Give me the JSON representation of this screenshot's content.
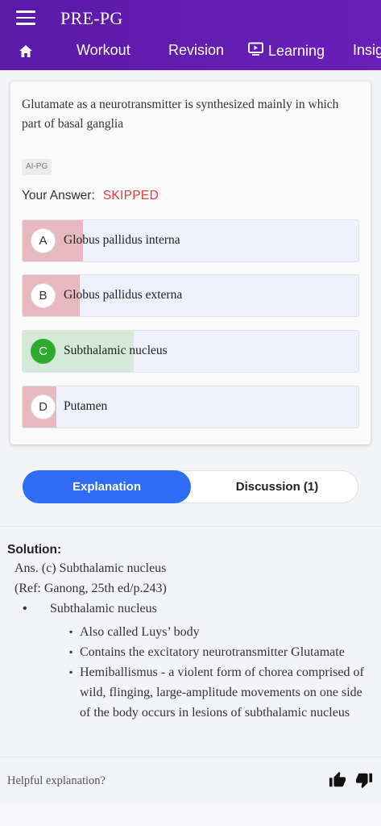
{
  "app": {
    "title": "PRE-PG"
  },
  "nav": {
    "items": [
      "Workout",
      "Revision",
      "Learning",
      "Insig"
    ]
  },
  "question": {
    "text": "Glutamate as a neurotransmitter is synthesized mainly in which part of basal ganglia",
    "tag": "AI-PG",
    "your_answer_label": "Your Answer:",
    "your_answer_status": "SKIPPED",
    "options": [
      {
        "letter": "A",
        "text": "Globus pallidus interna",
        "response_share": 0.18,
        "fill_color": "#e7b8c0"
      },
      {
        "letter": "B",
        "text": "Globus pallidus externa",
        "response_share": 0.17,
        "fill_color": "#e7b8c0"
      },
      {
        "letter": "C",
        "text": "Subthalamic nucleus",
        "response_share": 0.33,
        "fill_color": "#d5e9d9",
        "correct": true
      },
      {
        "letter": "D",
        "text": "Putamen",
        "response_share": 0.1,
        "fill_color": "#e7b8c0"
      }
    ]
  },
  "tabs": {
    "explanation": "Explanation",
    "discussion": "Discussion (1)"
  },
  "solution": {
    "label": "Solution:",
    "answer": "Ans. (c) Subthalamic nucleus",
    "ref": "(Ref: Ganong, 25th ed/p.243)",
    "bullet": "Subthalamic nucleus",
    "sub_items": [
      "Also called Luys’ body",
      "Contains the excitatory neurotransmitter Glutamate",
      "Hemiballismus - a violent form of chorea comprised of wild, flinging, large-amplitude movements on one side of the body occurs in lesions of subthalamic nucleus"
    ]
  },
  "feedback": {
    "prompt": "Helpful explanation?"
  },
  "colors": {
    "header": "#5a1aa6",
    "accent": "#2f6cf6",
    "skipped": "#e0393e",
    "correct": "#2eaa2e"
  },
  "icons": [
    "menu-icon",
    "home-icon",
    "tv-icon",
    "thumbs-up-icon",
    "thumbs-down-icon"
  ]
}
